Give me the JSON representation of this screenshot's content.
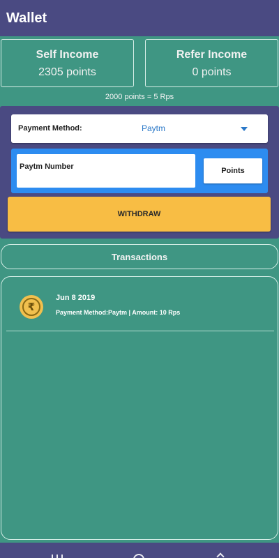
{
  "appbar": {
    "title": "Wallet"
  },
  "income": {
    "self": {
      "title": "Self Income",
      "value": "2305 points"
    },
    "refer": {
      "title": "Refer Income",
      "value": "0 points"
    }
  },
  "rate_text": "2000 points = 5 Rps",
  "payment": {
    "method_label": "Payment Method:",
    "method_value": "Paytm",
    "number_label": "Paytm Number",
    "points_button": "Points",
    "withdraw_button": "WITHDRAW"
  },
  "transactions": {
    "header": "Transactions",
    "items": [
      {
        "date": "Jun 8 2019",
        "detail": "Payment Method:Paytm | Amount: 10 Rps",
        "icon": "rupee-icon"
      }
    ]
  },
  "colors": {
    "background": "#3f9683",
    "appbar": "#4a4a82",
    "accent_blue": "#2d8cf0",
    "withdraw": "#f8bd44"
  }
}
